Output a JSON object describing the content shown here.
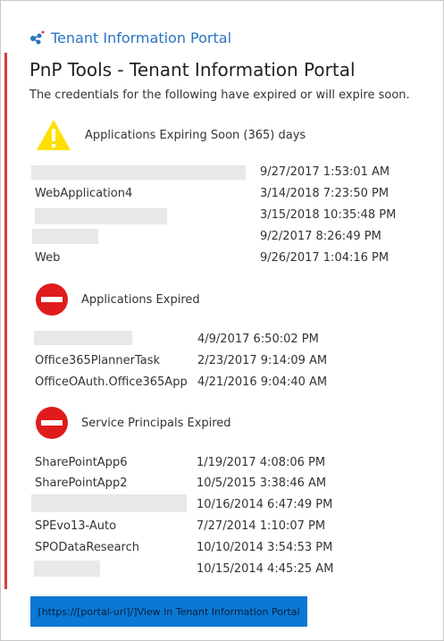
{
  "header": {
    "portal_name": "Tenant Information Portal"
  },
  "title": "PnP Tools - Tenant Information Portal",
  "subtitle": "The credentials for the following have expired or will expire soon.",
  "sections": [
    {
      "label": "Applications Expiring Soon (365) days",
      "icon": "warning-triangle-icon",
      "rows": [
        {
          "name": "",
          "date": "9/27/2017 1:53:01 AM"
        },
        {
          "name": "WebApplication4",
          "date": "3/14/2018 7:23:50 PM"
        },
        {
          "name": "",
          "date": "3/15/2018 10:35:48 PM"
        },
        {
          "name": "",
          "date": "9/2/2017 8:26:49 PM"
        },
        {
          "name": "Web",
          "date": "9/26/2017 1:04:16 PM"
        }
      ]
    },
    {
      "label": "Applications Expired",
      "icon": "stop-icon",
      "rows": [
        {
          "name": "",
          "date": "4/9/2017 6:50:02 PM"
        },
        {
          "name": "Office365PlannerTask",
          "date": "2/23/2017 9:14:09 AM"
        },
        {
          "name": "OfficeOAuth.Office365App",
          "date": "4/21/2016 9:04:40 AM"
        }
      ]
    },
    {
      "label": "Service Principals Expired",
      "icon": "stop-icon",
      "rows": [
        {
          "name": "SharePointApp6",
          "date": "1/19/2017 4:08:06 PM"
        },
        {
          "name": "SharePointApp2",
          "date": "10/5/2015 3:38:46 AM"
        },
        {
          "name": "",
          "date": "10/16/2014 6:47:49 PM"
        },
        {
          "name": "SPEvo13-Auto",
          "date": "7/27/2014 1:10:07 PM"
        },
        {
          "name": "SPODataResearch",
          "date": "10/10/2014 3:54:53 PM"
        },
        {
          "name": "",
          "date": "10/15/2014 4:45:25 AM"
        }
      ]
    }
  ],
  "cta_label": "[https://[portal-url]/]View in Tenant Information Portal",
  "colors": {
    "accent_bar": "#d83b3b",
    "brand": "#2a74c0",
    "button": "#0a78d4",
    "warning": "#ffe000",
    "stop": "#e01b1b"
  }
}
